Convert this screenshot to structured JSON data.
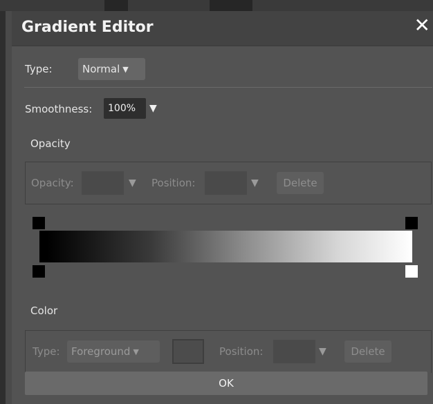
{
  "dialog": {
    "title": "Gradient Editor",
    "close_icon": "close-icon"
  },
  "type_row": {
    "label": "Type:",
    "value": "Normal"
  },
  "smoothness": {
    "label": "Smoothness:",
    "value": "100%"
  },
  "opacity_section": {
    "heading": "Opacity",
    "opacity_label": "Opacity:",
    "opacity_value": "",
    "position_label": "Position:",
    "position_value": "",
    "delete_label": "Delete"
  },
  "gradient": {
    "start_color": "#000000",
    "end_color": "#ffffff",
    "opacity_stops": [
      "left",
      "right"
    ],
    "color_stops": [
      {
        "color": "#000000"
      },
      {
        "color": "#ffffff"
      }
    ]
  },
  "color_section": {
    "heading": "Color",
    "type_label": "Type:",
    "type_value": "Foreground",
    "position_label": "Position:",
    "position_value": "",
    "delete_label": "Delete"
  },
  "ok_label": "OK"
}
